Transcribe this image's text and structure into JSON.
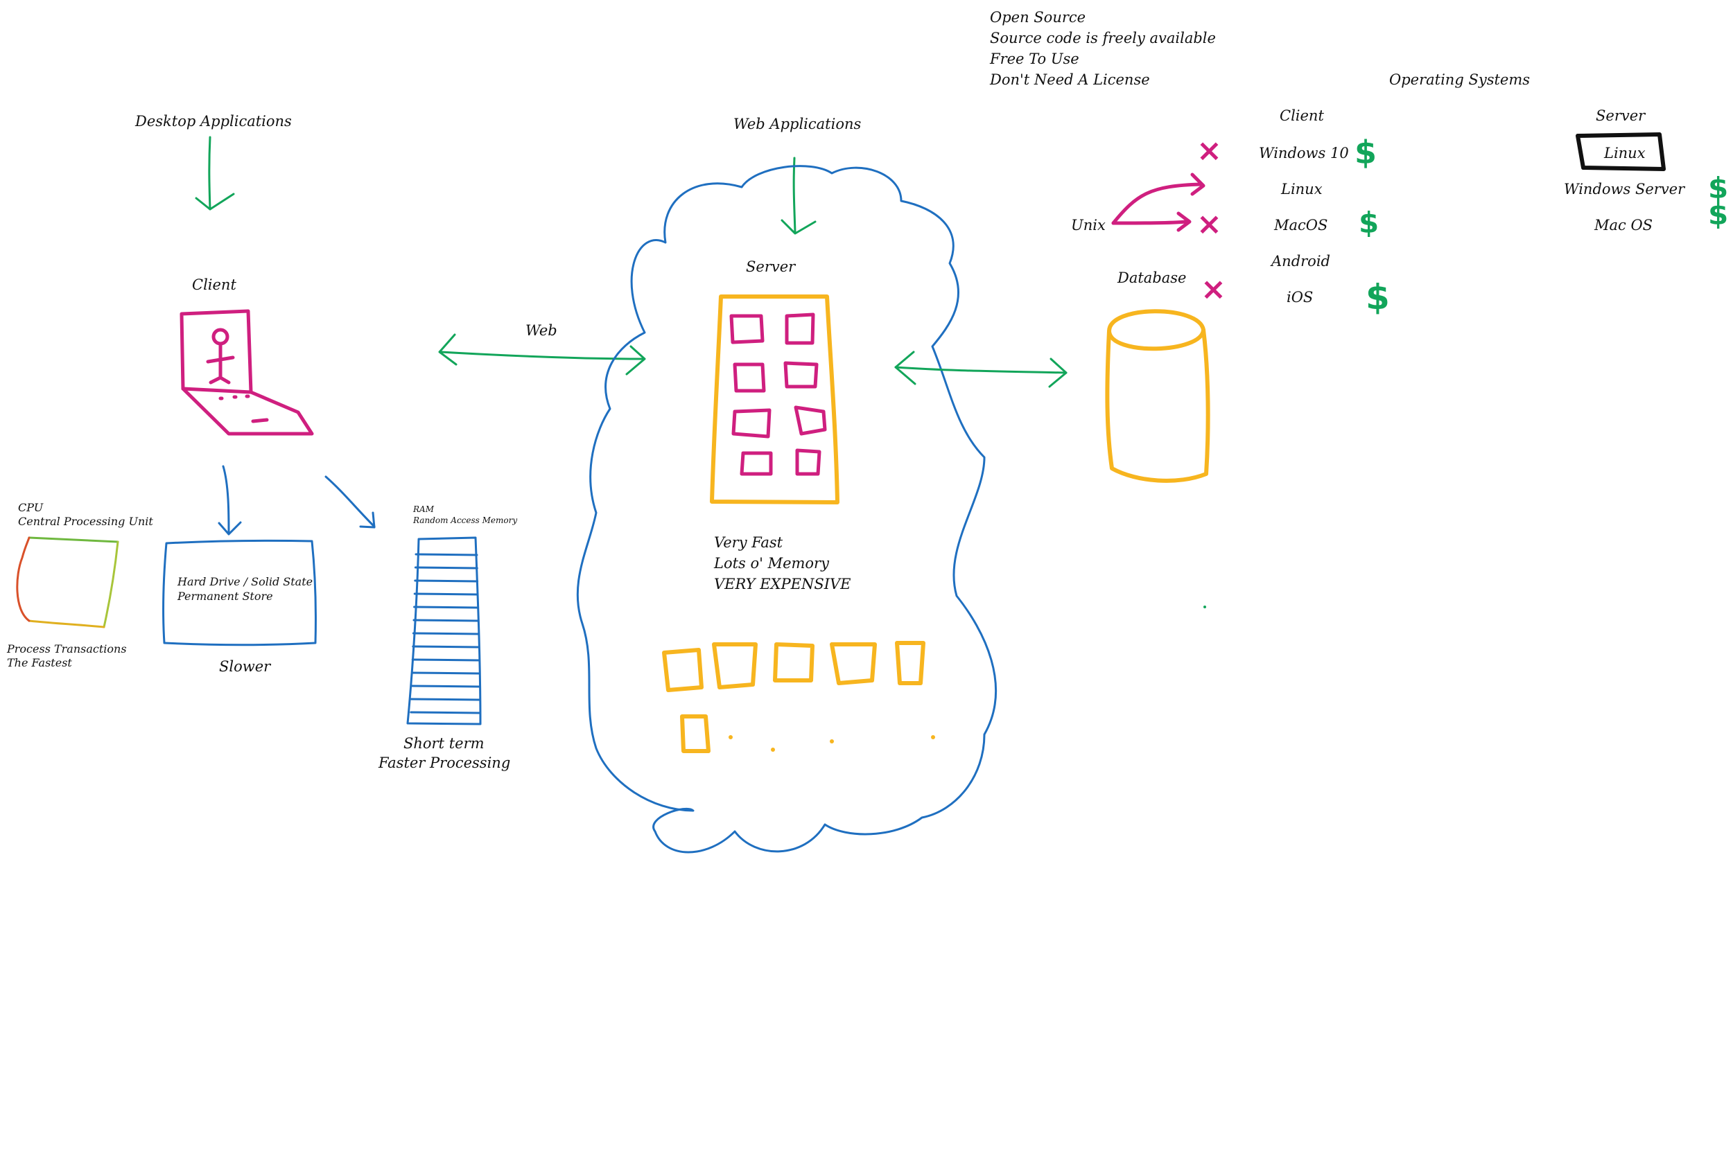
{
  "labels": {
    "desktop_apps": "Desktop Applications",
    "web_apps": "Web Applications",
    "client": "Client",
    "web": "Web",
    "server": "Server",
    "database": "Database",
    "unix": "Unix",
    "cpu_title": "CPU",
    "cpu_full": "Central Processing Unit",
    "cpu_note1": "Process Transactions",
    "cpu_note2": "The Fastest",
    "hd_line1": "Hard Drive / Solid State",
    "hd_line2": "Permanent Store",
    "slower": "Slower",
    "ram_title": "RAM",
    "ram_full": "Random Access Memory",
    "ram_note1": "Short term",
    "ram_note2": "Faster Processing",
    "server_note1": "Very Fast",
    "server_note2": "Lots o' Memory",
    "server_note3": "VERY EXPENSIVE"
  },
  "open_source": [
    "Open Source",
    "Source code is freely available",
    "Free To Use",
    "Don't Need A License"
  ],
  "os": {
    "title": "Operating Systems",
    "client_header": "Client",
    "server_header": "Server",
    "client_items": [
      "Windows 10",
      "Linux",
      "MacOS",
      "Android",
      "iOS"
    ],
    "server_items": [
      "Linux",
      "Windows Server",
      "Mac OS"
    ],
    "cost_marker": "$",
    "unix_marker": "×"
  },
  "colors": {
    "structure": "#1f6fc0",
    "arrows_and_cost": "#12a55a",
    "client_and_unix": "#cf1f7f",
    "server_and_database": "#f7b51f",
    "highlight_box": "#111111"
  }
}
